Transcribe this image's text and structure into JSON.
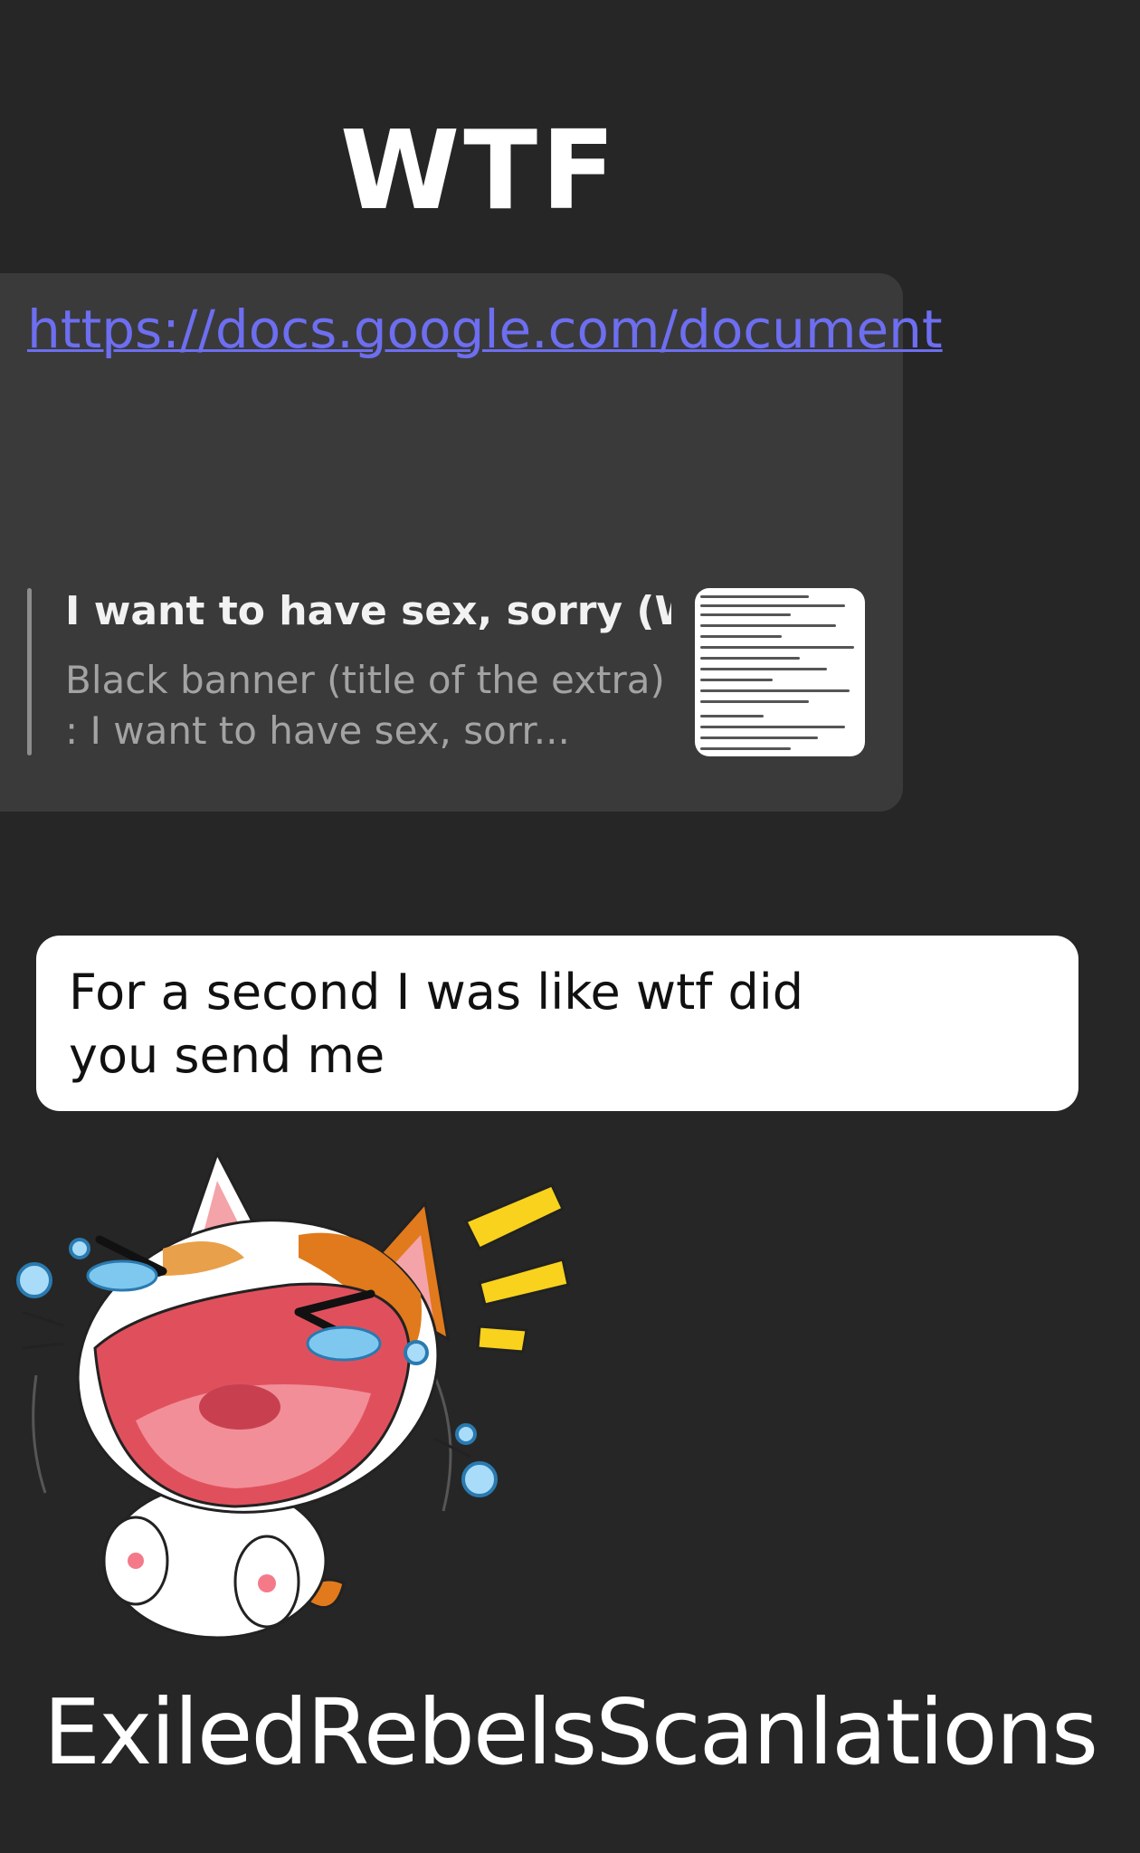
{
  "header": {
    "title": "WTF"
  },
  "link_message": {
    "url": "https://docs.google.com/document",
    "preview_title": "I want to have sex, sorry (Wa...",
    "preview_description": "Black banner (title of the extra) : I want to have sex, sorr..."
  },
  "reply_message": {
    "text": "For a second I was like wtf did you send me"
  },
  "sticker": {
    "icon": "crying-laughing-cat-sticker"
  },
  "watermark": {
    "text": "ExiledRebelsScanlations"
  },
  "colors": {
    "background": "#262626",
    "link_bubble": "#3a3a3b",
    "link": "#6d6ef0",
    "reply_bubble": "#ffffff"
  }
}
